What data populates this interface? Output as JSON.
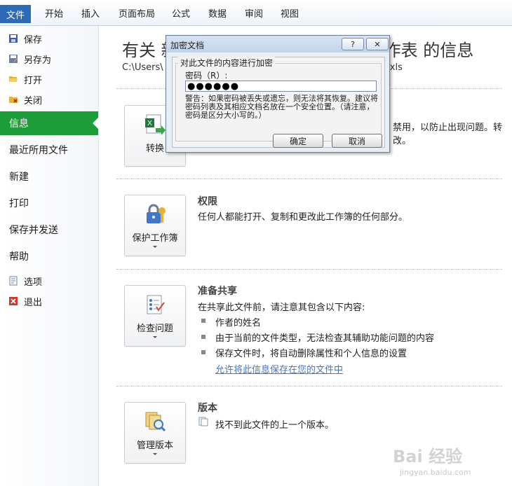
{
  "ribbon": {
    "file_tab": "文件",
    "tabs": [
      "开始",
      "插入",
      "页面布局",
      "公式",
      "数据",
      "审阅",
      "视图"
    ]
  },
  "sidebar": {
    "save": "保存",
    "save_as": "另存为",
    "open": "打开",
    "close": "关闭",
    "info": "信息",
    "recent": "最近所用文件",
    "new": "新建",
    "print": "打印",
    "save_send": "保存并发送",
    "help": "帮助",
    "options": "选项",
    "exit": "退出"
  },
  "main": {
    "title_left": "有关 新",
    "title_right": "工作表 的信息",
    "path_left": "C:\\Users\\",
    "path_right": ".xls",
    "convert_label": "转换",
    "convert_text_1": "禁用，以防止出现问题。转",
    "convert_text_2": "改。",
    "permissions": {
      "title": "权限",
      "button": "保护工作簿",
      "text": "任何人都能打开、复制和更改此工作簿的任何部分。"
    },
    "prepare": {
      "title": "准备共享",
      "button": "检查问题",
      "intro": "在共享此文件前，请注意其包含以下内容:",
      "bullets": [
        "作者的姓名",
        "由于当前的文件类型，无法检查其辅助功能问题的内容",
        "保存文件时，将自动删除属性和个人信息的设置"
      ],
      "link": "允许将此信息保存在您的文件中"
    },
    "versions": {
      "title": "版本",
      "button": "管理版本",
      "text": "找不到此文件的上一个版本。"
    }
  },
  "dialog": {
    "title": "加密文档",
    "help_glyph": "?",
    "close_glyph": "✕",
    "group_label": "对此文件的内容进行加密",
    "password_label": "密码（R）:",
    "password_value": "●●●●●●",
    "warning": "警告：如果密码被丢失或遗忘，则无法将其恢复。建议将密码列表及其相应文档名放在一个安全位置。（请注意，密码是区分大小写的。）",
    "ok": "确定",
    "cancel": "取消"
  },
  "watermark": {
    "text": "Bai 经验",
    "sub": "jingyan.baidu.com"
  },
  "colors": {
    "accent_green": "#1e9e3a",
    "file_tab_blue": "#2d6bb8",
    "link_blue": "#4b76b8"
  }
}
